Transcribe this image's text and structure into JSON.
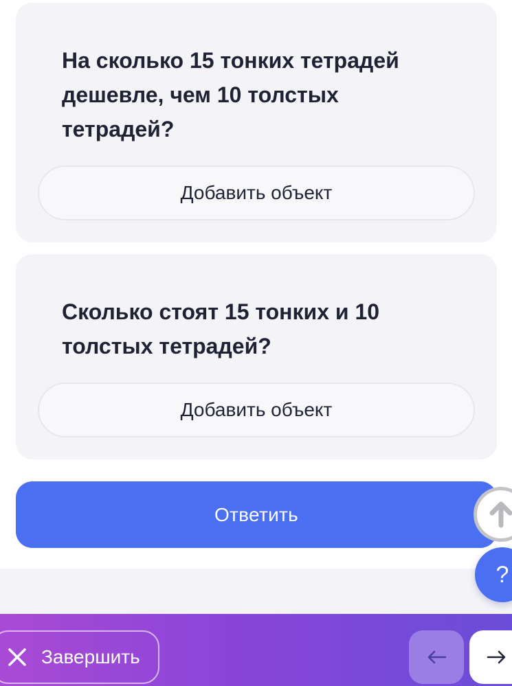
{
  "cards": [
    {
      "question": "На сколько 15 тонких тетрадей дешевле, чем 10 толстых тетрадей?",
      "add_button_label": "Добавить объект"
    },
    {
      "question": "Сколько стоят 15 тонких и 10 толстых тетрадей?",
      "add_button_label": "Добавить объект"
    }
  ],
  "answer_button_label": "Ответить",
  "help_button": {
    "label": "?",
    "icon": "question-icon"
  },
  "scroll_up_button": {
    "icon": "arrow-up-icon"
  },
  "footer": {
    "finish_label": "Завершить",
    "finish_icon": "close-icon",
    "prev_icon": "arrow-left-icon",
    "next_icon": "arrow-right-icon"
  },
  "colors": {
    "accent": "#4b6ff1",
    "card_bg": "#f3f3f8",
    "text": "#1e2233",
    "footer_gradient_start": "#a94ad6",
    "footer_gradient_end": "#6a4dd8"
  }
}
